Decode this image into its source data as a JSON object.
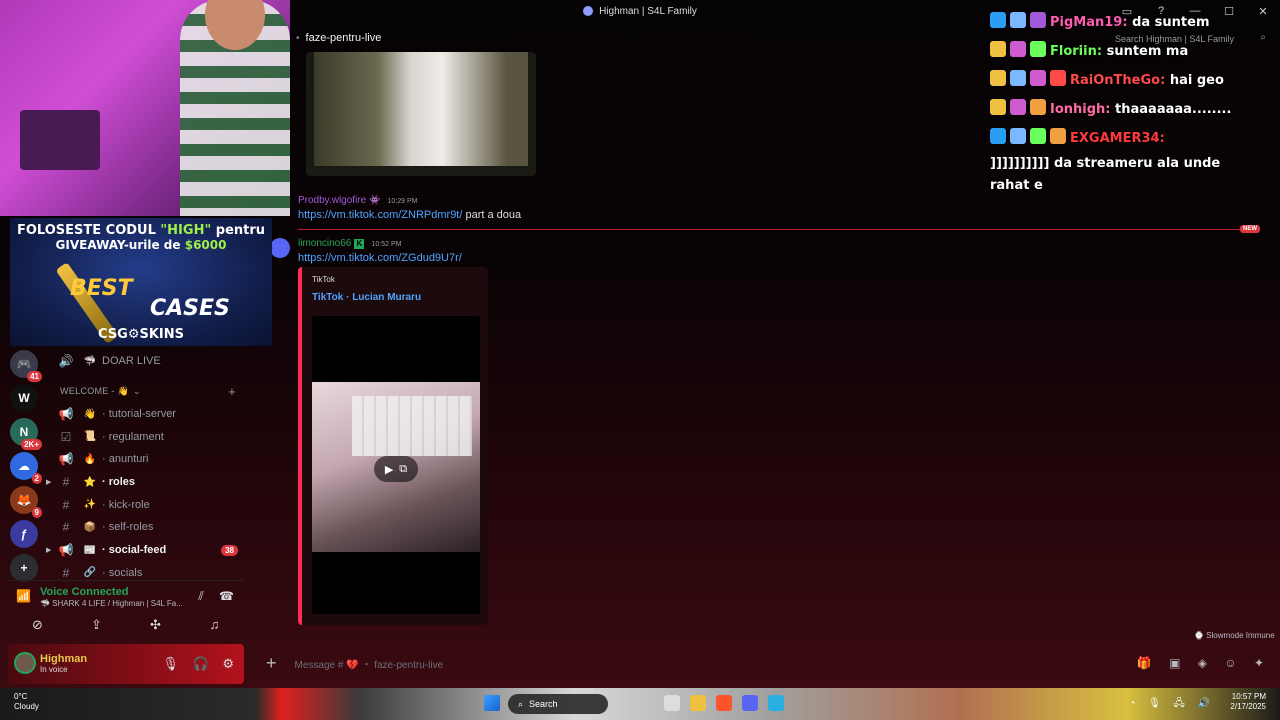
{
  "window": {
    "title": "Highman | S4L Family"
  },
  "header": {
    "channel": "faze-pentru-live",
    "search_placeholder": "Search Highman | S4L Family"
  },
  "ad": {
    "line1_pre": "FOLOSESTE CODUL ",
    "line1_code": "\"HIGH\"",
    "line1_post": " pentru",
    "line2_pre": "GIVEAWAY-urile de ",
    "line2_amount": "$6000",
    "best": "BEST",
    "cases": "CASES",
    "brand": "CSG⚙SKINS"
  },
  "servers": [
    {
      "label": "🎮",
      "color": "#3a3a4a",
      "badge": "41"
    },
    {
      "label": "W",
      "color": "#111111",
      "badge": ""
    },
    {
      "label": "N",
      "color": "#2a6a5a",
      "badge": "2K+"
    },
    {
      "label": "☁",
      "color": "#2f6ae0",
      "badge": "2"
    },
    {
      "label": "🦊",
      "color": "#8a3a1a",
      "badge": "9"
    },
    {
      "label": "ƒ",
      "color": "#3a3aa0",
      "badge": ""
    },
    {
      "label": "+",
      "color": "#2b2d31",
      "badge": ""
    }
  ],
  "sidebar": {
    "top_channel": {
      "icon": "🔊",
      "emoji": "🦈",
      "name": "DOAR LIVE"
    },
    "category": "WELCOME - 👋",
    "channels": [
      {
        "icon": "📢",
        "emoji": "👋",
        "name": "tutorial-server",
        "bold": false,
        "count": ""
      },
      {
        "icon": "☑",
        "emoji": "📜",
        "name": "regulament",
        "bold": false,
        "count": ""
      },
      {
        "icon": "📢",
        "emoji": "🔥",
        "name": "anunturi",
        "bold": false,
        "count": ""
      },
      {
        "icon": "#",
        "emoji": "⭐",
        "name": "roles",
        "bold": true,
        "count": ""
      },
      {
        "icon": "#",
        "emoji": "✨",
        "name": "kick-role",
        "bold": false,
        "count": ""
      },
      {
        "icon": "#",
        "emoji": "📦",
        "name": "self-roles",
        "bold": false,
        "count": ""
      },
      {
        "icon": "📢",
        "emoji": "📰",
        "name": "social-feed",
        "bold": true,
        "count": "38"
      },
      {
        "icon": "#",
        "emoji": "🔗",
        "name": "socials",
        "bold": false,
        "count": ""
      }
    ]
  },
  "voice": {
    "status": "Voice Connected",
    "channel": "🦈 SHARK 4 LIFE / Highman | S4L Fa..."
  },
  "user": {
    "name": "Highman",
    "status": "In voice"
  },
  "messages": [
    {
      "author": "Prodby.wlgofire",
      "author_color": "#a259d9",
      "time": "10:29 PM",
      "link": "https://vm.tiktok.com/ZNRPdmr9t/",
      "text": "part a doua"
    },
    {
      "author": "limoncino66",
      "author_color": "#23a55a",
      "time": "10:52 PM",
      "link": "https://vm.tiktok.com/ZGdud9U7r/",
      "text": ""
    }
  ],
  "new_tag": "NEW",
  "embed": {
    "provider": "TikTok",
    "title": "TikTok · Lucian Muraru"
  },
  "slowmode": "Slowmode Immune",
  "composer": {
    "placeholder": "Message # 💔 ・ faze-pentru-live"
  },
  "stream_chat": [
    {
      "user": "PigMan19:",
      "color": "#ff5db1",
      "msg": "da suntem",
      "badges": [
        "#2a9df4",
        "#7ab8ff",
        "#a259d9"
      ]
    },
    {
      "user": "Floriin:",
      "color": "#6aff5a",
      "msg": "suntem ma",
      "badges": [
        "#f0c040",
        "#d05ad0",
        "#6aff5a"
      ]
    },
    {
      "user": "RaiOnTheGo:",
      "color": "#ff4a4a",
      "msg": "hai geo",
      "badges": [
        "#f0c040",
        "#7ab8ff",
        "#d05ad0",
        "#ff4a4a"
      ]
    },
    {
      "user": "Ionhigh:",
      "color": "#ff6aa8",
      "msg": "thaaaaaaa........",
      "badges": [
        "#f0c040",
        "#d05ad0",
        "#f0a040"
      ]
    },
    {
      "user": "EXGAMER34:",
      "color": "#ff3a3a",
      "msg": "]]]]]]]]]] da streameru ala unde rahat e",
      "badges": [
        "#2a9df4",
        "#7ab8ff",
        "#6aff5a",
        "#f0a040"
      ]
    }
  ],
  "taskbar": {
    "temp": "0°C",
    "weather": "Cloudy",
    "search": "Search",
    "time": "10:57 PM",
    "date": "2/17/2025"
  }
}
